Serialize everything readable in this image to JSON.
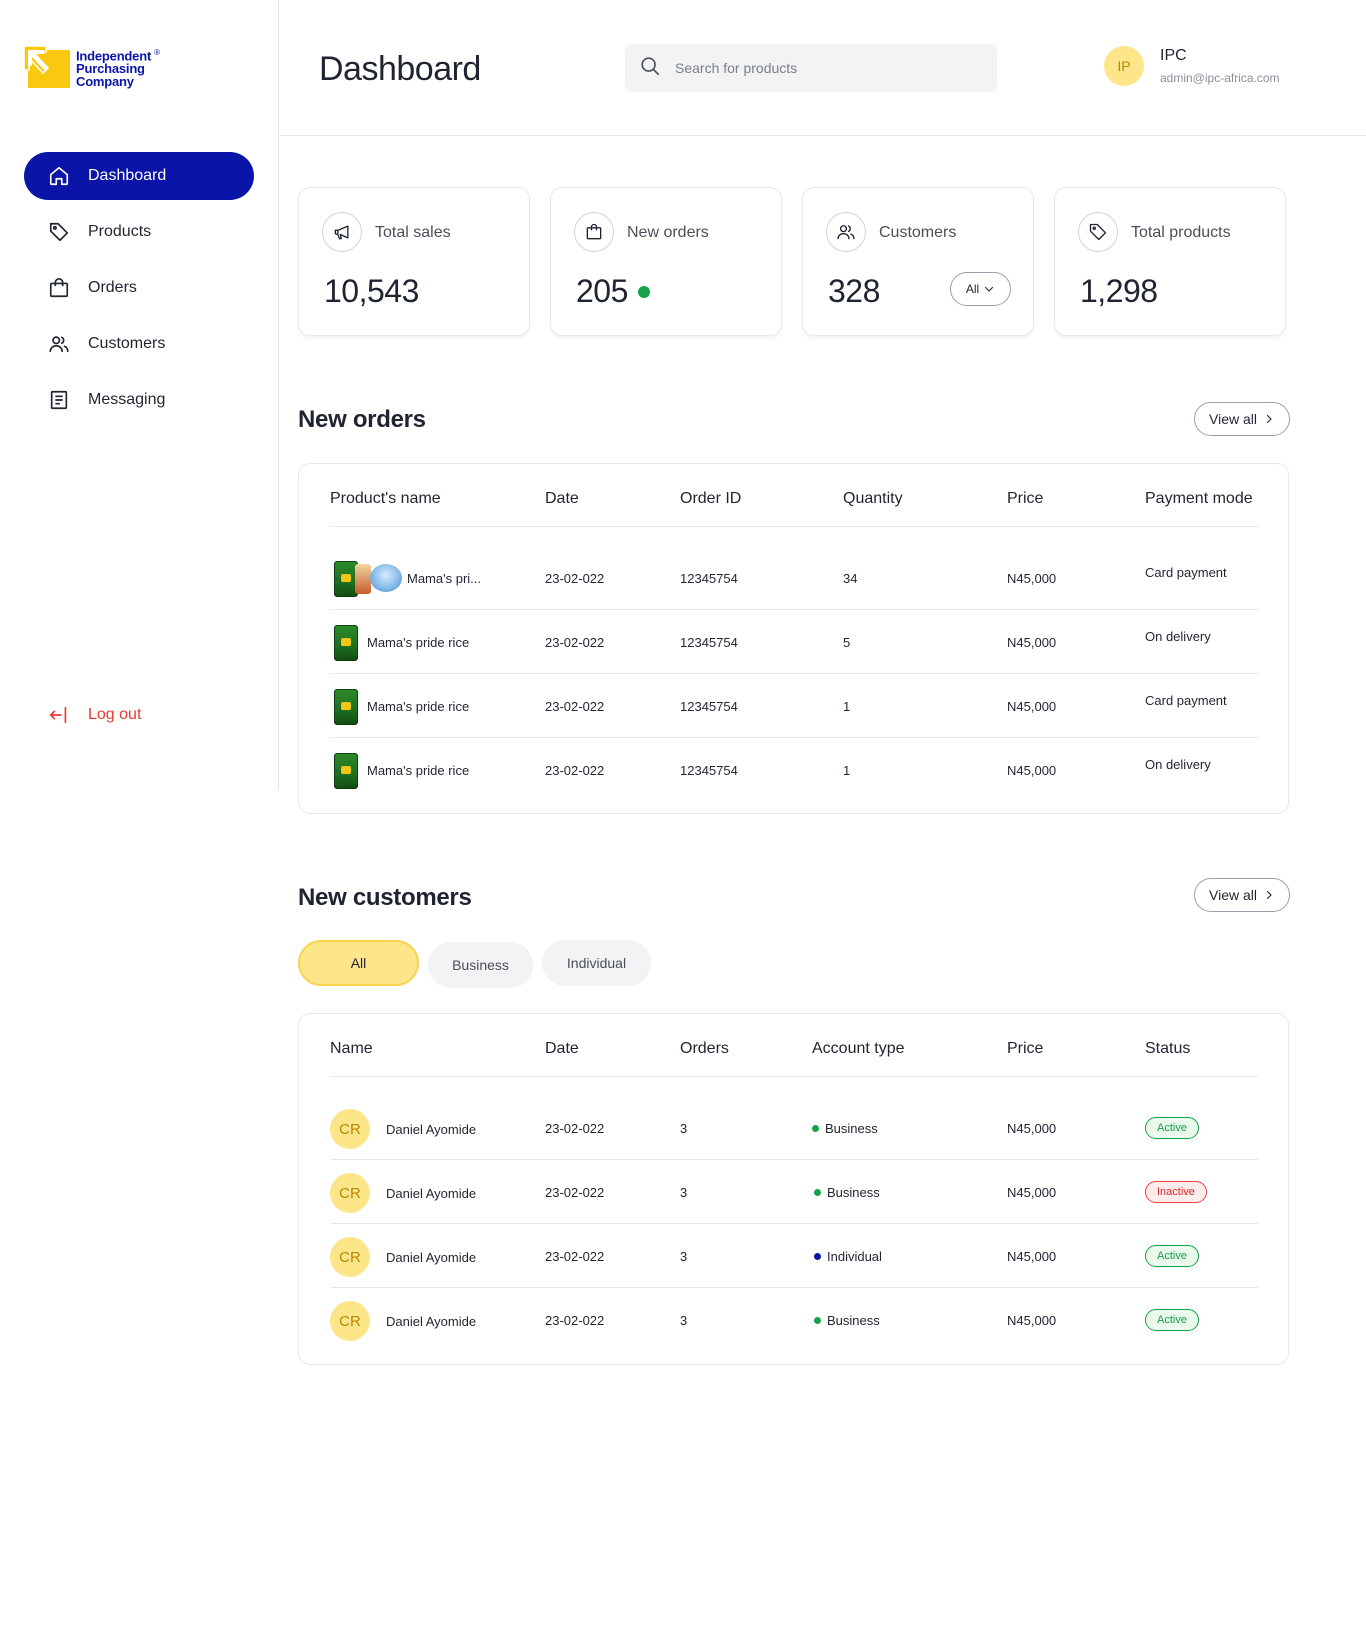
{
  "brand": {
    "name_line1": "Independent",
    "name_line2": "Purchasing",
    "name_line3": "Company",
    "registered": "®",
    "colors": {
      "primary": "#0a14a8",
      "accent": "#f8c90f",
      "danger": "#e8392f"
    }
  },
  "sidebar": {
    "items": [
      {
        "label": "Dashboard",
        "icon": "home-icon",
        "active": true
      },
      {
        "label": "Products",
        "icon": "tag-icon",
        "active": false
      },
      {
        "label": "Orders",
        "icon": "shopping-bag-icon",
        "active": false
      },
      {
        "label": "Customers",
        "icon": "users-icon",
        "active": false
      },
      {
        "label": "Messaging",
        "icon": "document-icon",
        "active": false
      }
    ],
    "logout_label": "Log out"
  },
  "header": {
    "title": "Dashboard",
    "search_placeholder": "Search for products",
    "user": {
      "initials": "IP",
      "name": "IPC",
      "email": "admin@ipc-africa.com"
    }
  },
  "stats": [
    {
      "label": "Total sales",
      "value": "10,543",
      "icon": "megaphone-icon"
    },
    {
      "label": "New orders",
      "value": "205",
      "icon": "shopping-bag-icon"
    },
    {
      "label": "Customers",
      "value": "328",
      "icon": "users-icon",
      "filter": "All"
    },
    {
      "label": "Total products",
      "value": "1,298",
      "icon": "tag-icon"
    }
  ],
  "orders": {
    "title": "New orders",
    "view_all": "View all",
    "columns": [
      "Product's name",
      "Date",
      "Order ID",
      "Quantity",
      "Price",
      "Payment mode"
    ],
    "rows": [
      {
        "product": "Mama's pri...",
        "date": "23-02-022",
        "order_id": "12345754",
        "quantity": "34",
        "price": "N45,000",
        "payment": "Card payment"
      },
      {
        "product": "Mama's pride rice",
        "date": "23-02-022",
        "order_id": "12345754",
        "quantity": "5",
        "price": "N45,000",
        "payment": "On delivery"
      },
      {
        "product": "Mama's pride rice",
        "date": "23-02-022",
        "order_id": "12345754",
        "quantity": "1",
        "price": "N45,000",
        "payment": "Card payment"
      },
      {
        "product": "Mama's pride rice",
        "date": "23-02-022",
        "order_id": "12345754",
        "quantity": "1",
        "price": "N45,000",
        "payment": "On delivery"
      }
    ]
  },
  "customers": {
    "title": "New customers",
    "view_all": "View all",
    "filters": [
      "All",
      "Business",
      "Individual"
    ],
    "selected_filter": "All",
    "columns": [
      "Name",
      "Date",
      "Orders",
      "Account type",
      "Price",
      "Status"
    ],
    "rows": [
      {
        "initials": "CR",
        "name": "Daniel Ayomide",
        "date": "23-02-022",
        "orders": "3",
        "account_type": "Business",
        "type_color": "#16a34a",
        "price": "N45,000",
        "status": "Active"
      },
      {
        "initials": "CR",
        "name": "Daniel Ayomide",
        "date": "23-02-022",
        "orders": "3",
        "account_type": "Business",
        "type_color": "#16a34a",
        "price": "N45,000",
        "status": "Inactive"
      },
      {
        "initials": "CR",
        "name": "Daniel Ayomide",
        "date": "23-02-022",
        "orders": "3",
        "account_type": "Individual",
        "type_color": "#0a14a8",
        "price": "N45,000",
        "status": "Active"
      },
      {
        "initials": "CR",
        "name": "Daniel Ayomide",
        "date": "23-02-022",
        "orders": "3",
        "account_type": "Business",
        "type_color": "#16a34a",
        "price": "N45,000",
        "status": "Active"
      }
    ]
  }
}
